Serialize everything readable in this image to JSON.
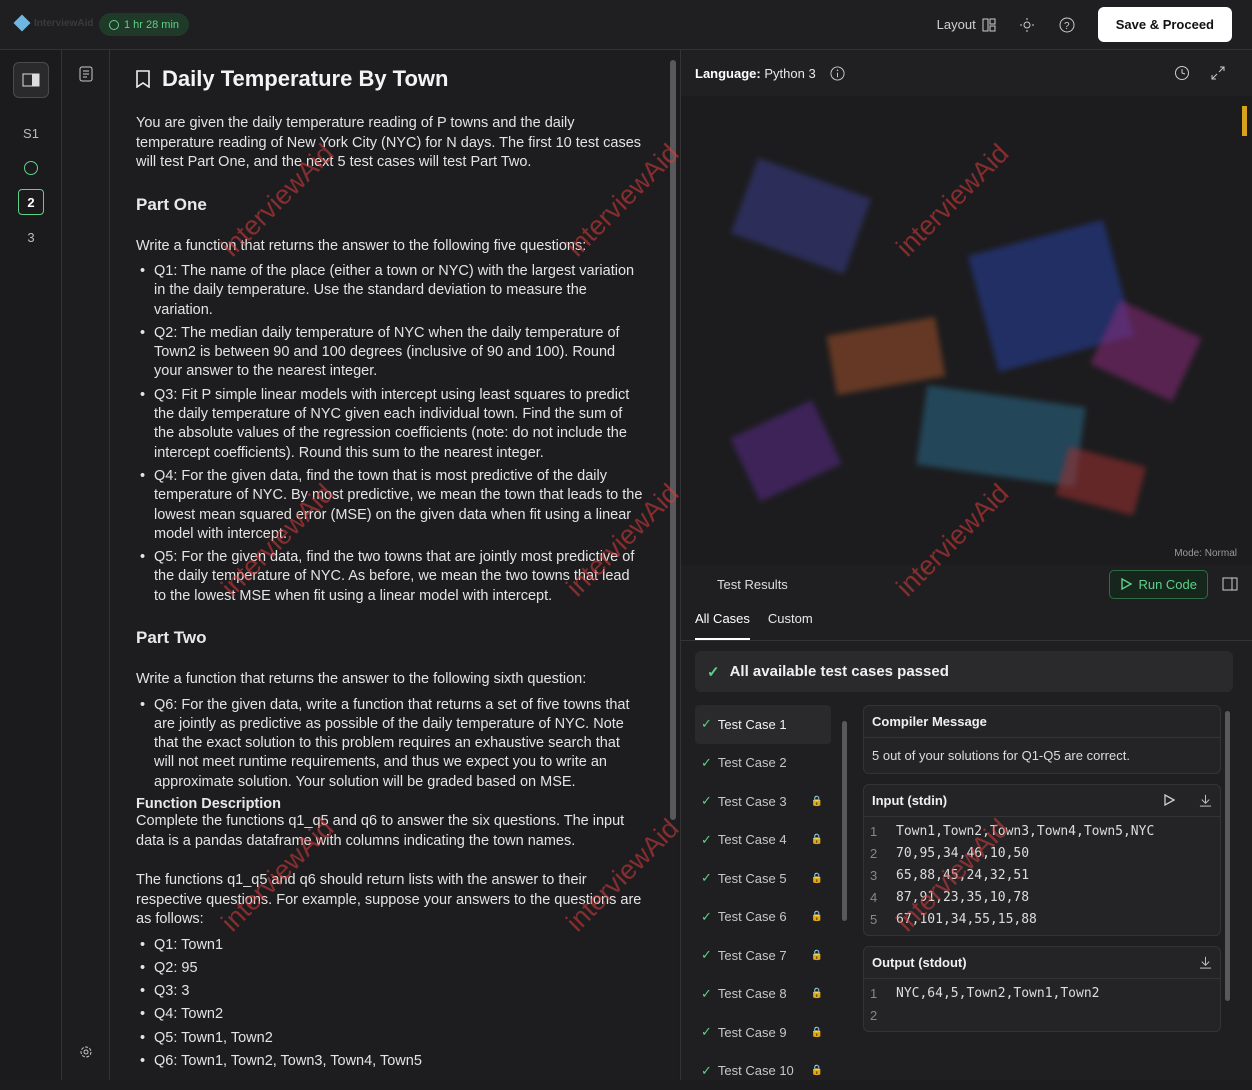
{
  "topbar": {
    "logo_text": "InterviewAid",
    "timer": "1 hr 28 min",
    "layout_label": "Layout",
    "save_label": "Save & Proceed"
  },
  "rail": {
    "items": [
      "S1",
      "2",
      "3"
    ]
  },
  "problem": {
    "title": "Daily Temperature By Town",
    "intro": "You are given the daily temperature reading of P towns and the daily temperature reading of New York City (NYC) for N days. The first 10 test cases will test Part One, and the next 5 test cases will test Part Two.",
    "part_one_heading": "Part One",
    "part_one_intro": "Write a function that returns the answer to the following five questions:",
    "q1": "Q1: The name of the place (either a town or NYC) with the largest variation in the daily temperature.  Use the standard deviation to measure the variation.",
    "q2": "Q2: The median daily temperature of NYC when the daily temperature of Town2 is between 90 and 100 degrees (inclusive of 90 and 100).  Round your answer to the nearest integer.",
    "q3": "Q3: Fit P simple linear models with intercept using least squares to predict the daily temperature of NYC given each individual town.  Find the sum of the absolute values of the regression coefficients (note: do not include the intercept coefficients). Round this sum to the nearest integer.",
    "q4": "Q4: For the given data, find the town that is most predictive of the daily temperature of NYC.  By most predictive, we mean the town that leads to the lowest mean squared error (MSE) on the given data when fit using a linear model with intercept.",
    "q5": "Q5: For the given data, find the two towns that are jointly most predictive of the daily temperature of NYC.  As before, we mean the two towns that lead to the lowest MSE when fit using a linear model with intercept.",
    "part_two_heading": "Part Two",
    "part_two_intro": "Write a function that returns the answer to the following sixth question:",
    "q6": "Q6: For the given data, write a function that returns a set of five towns that are jointly as predictive as possible of the daily temperature of NYC. Note that the exact solution to this problem requires an exhaustive search that will not meet runtime requirements, and thus we expect you to write an approximate solution. Your solution will be graded based on MSE.",
    "fd_heading": "Function Description",
    "fd_text": "Complete the functions q1_q5 and q6 to answer the six questions. The input data is a pandas dataframe with columns indicating the town names.",
    "return_text": "The functions q1_q5 and q6 should return lists with the answer to their respective questions. For example, suppose your answers to the questions are as follows:",
    "answers": [
      "Q1: Town1",
      "Q2: 95",
      "Q3: 3",
      "Q4: Town2",
      "Q5: Town1, Town2",
      "Q6: Town1, Town2, Town3, Town4, Town5"
    ]
  },
  "editor": {
    "language_label": "Language:",
    "language": "Python 3",
    "mode": "Mode: Normal"
  },
  "results": {
    "title": "Test Results",
    "run_label": "Run Code",
    "tabs": [
      "All Cases",
      "Custom"
    ],
    "banner": "All available test cases passed",
    "cases": [
      "Test Case 1",
      "Test Case 2",
      "Test Case 3",
      "Test Case 4",
      "Test Case 5",
      "Test Case 6",
      "Test Case 7",
      "Test Case 8",
      "Test Case 9",
      "Test Case 10"
    ],
    "compiler_title": "Compiler Message",
    "compiler_msg": "5 out of your solutions for Q1-Q5 are correct.",
    "input_title": "Input (stdin)",
    "input_lines": [
      "Town1,Town2,Town3,Town4,Town5,NYC",
      "70,95,34,46,10,50",
      "65,88,45,24,32,51",
      "87,91,23,35,10,78",
      "67,101,34,55,15,88"
    ],
    "output_title": "Output (stdout)",
    "output_lines": [
      "NYC,64,5,Town2,Town1,Town2",
      ""
    ]
  },
  "watermark": "interviewAid",
  "colors": {
    "accent_green": "#5fd08a",
    "watermark_red": "#dc3c3c"
  }
}
